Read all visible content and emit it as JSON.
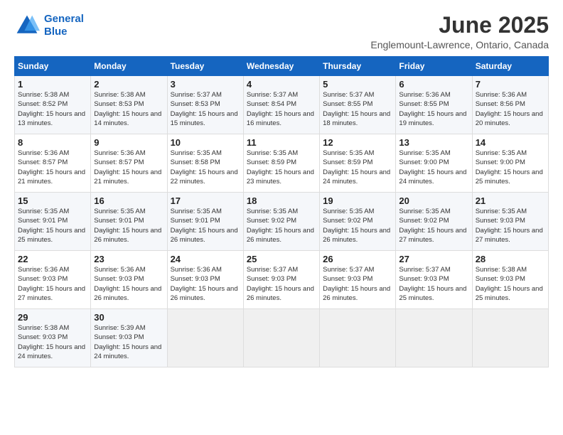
{
  "logo": {
    "line1": "General",
    "line2": "Blue"
  },
  "title": "June 2025",
  "subtitle": "Englemount-Lawrence, Ontario, Canada",
  "days_header": [
    "Sunday",
    "Monday",
    "Tuesday",
    "Wednesday",
    "Thursday",
    "Friday",
    "Saturday"
  ],
  "weeks": [
    [
      {
        "num": "1",
        "rise": "5:38 AM",
        "set": "8:52 PM",
        "daylight": "15 hours and 13 minutes."
      },
      {
        "num": "2",
        "rise": "5:38 AM",
        "set": "8:53 PM",
        "daylight": "15 hours and 14 minutes."
      },
      {
        "num": "3",
        "rise": "5:37 AM",
        "set": "8:53 PM",
        "daylight": "15 hours and 15 minutes."
      },
      {
        "num": "4",
        "rise": "5:37 AM",
        "set": "8:54 PM",
        "daylight": "15 hours and 16 minutes."
      },
      {
        "num": "5",
        "rise": "5:37 AM",
        "set": "8:55 PM",
        "daylight": "15 hours and 18 minutes."
      },
      {
        "num": "6",
        "rise": "5:36 AM",
        "set": "8:55 PM",
        "daylight": "15 hours and 19 minutes."
      },
      {
        "num": "7",
        "rise": "5:36 AM",
        "set": "8:56 PM",
        "daylight": "15 hours and 20 minutes."
      }
    ],
    [
      {
        "num": "8",
        "rise": "5:36 AM",
        "set": "8:57 PM",
        "daylight": "15 hours and 21 minutes."
      },
      {
        "num": "9",
        "rise": "5:36 AM",
        "set": "8:57 PM",
        "daylight": "15 hours and 21 minutes."
      },
      {
        "num": "10",
        "rise": "5:35 AM",
        "set": "8:58 PM",
        "daylight": "15 hours and 22 minutes."
      },
      {
        "num": "11",
        "rise": "5:35 AM",
        "set": "8:59 PM",
        "daylight": "15 hours and 23 minutes."
      },
      {
        "num": "12",
        "rise": "5:35 AM",
        "set": "8:59 PM",
        "daylight": "15 hours and 24 minutes."
      },
      {
        "num": "13",
        "rise": "5:35 AM",
        "set": "9:00 PM",
        "daylight": "15 hours and 24 minutes."
      },
      {
        "num": "14",
        "rise": "5:35 AM",
        "set": "9:00 PM",
        "daylight": "15 hours and 25 minutes."
      }
    ],
    [
      {
        "num": "15",
        "rise": "5:35 AM",
        "set": "9:01 PM",
        "daylight": "15 hours and 25 minutes."
      },
      {
        "num": "16",
        "rise": "5:35 AM",
        "set": "9:01 PM",
        "daylight": "15 hours and 26 minutes."
      },
      {
        "num": "17",
        "rise": "5:35 AM",
        "set": "9:01 PM",
        "daylight": "15 hours and 26 minutes."
      },
      {
        "num": "18",
        "rise": "5:35 AM",
        "set": "9:02 PM",
        "daylight": "15 hours and 26 minutes."
      },
      {
        "num": "19",
        "rise": "5:35 AM",
        "set": "9:02 PM",
        "daylight": "15 hours and 26 minutes."
      },
      {
        "num": "20",
        "rise": "5:35 AM",
        "set": "9:02 PM",
        "daylight": "15 hours and 27 minutes."
      },
      {
        "num": "21",
        "rise": "5:35 AM",
        "set": "9:03 PM",
        "daylight": "15 hours and 27 minutes."
      }
    ],
    [
      {
        "num": "22",
        "rise": "5:36 AM",
        "set": "9:03 PM",
        "daylight": "15 hours and 27 minutes."
      },
      {
        "num": "23",
        "rise": "5:36 AM",
        "set": "9:03 PM",
        "daylight": "15 hours and 26 minutes."
      },
      {
        "num": "24",
        "rise": "5:36 AM",
        "set": "9:03 PM",
        "daylight": "15 hours and 26 minutes."
      },
      {
        "num": "25",
        "rise": "5:37 AM",
        "set": "9:03 PM",
        "daylight": "15 hours and 26 minutes."
      },
      {
        "num": "26",
        "rise": "5:37 AM",
        "set": "9:03 PM",
        "daylight": "15 hours and 26 minutes."
      },
      {
        "num": "27",
        "rise": "5:37 AM",
        "set": "9:03 PM",
        "daylight": "15 hours and 25 minutes."
      },
      {
        "num": "28",
        "rise": "5:38 AM",
        "set": "9:03 PM",
        "daylight": "15 hours and 25 minutes."
      }
    ],
    [
      {
        "num": "29",
        "rise": "5:38 AM",
        "set": "9:03 PM",
        "daylight": "15 hours and 24 minutes."
      },
      {
        "num": "30",
        "rise": "5:39 AM",
        "set": "9:03 PM",
        "daylight": "15 hours and 24 minutes."
      },
      null,
      null,
      null,
      null,
      null
    ]
  ]
}
